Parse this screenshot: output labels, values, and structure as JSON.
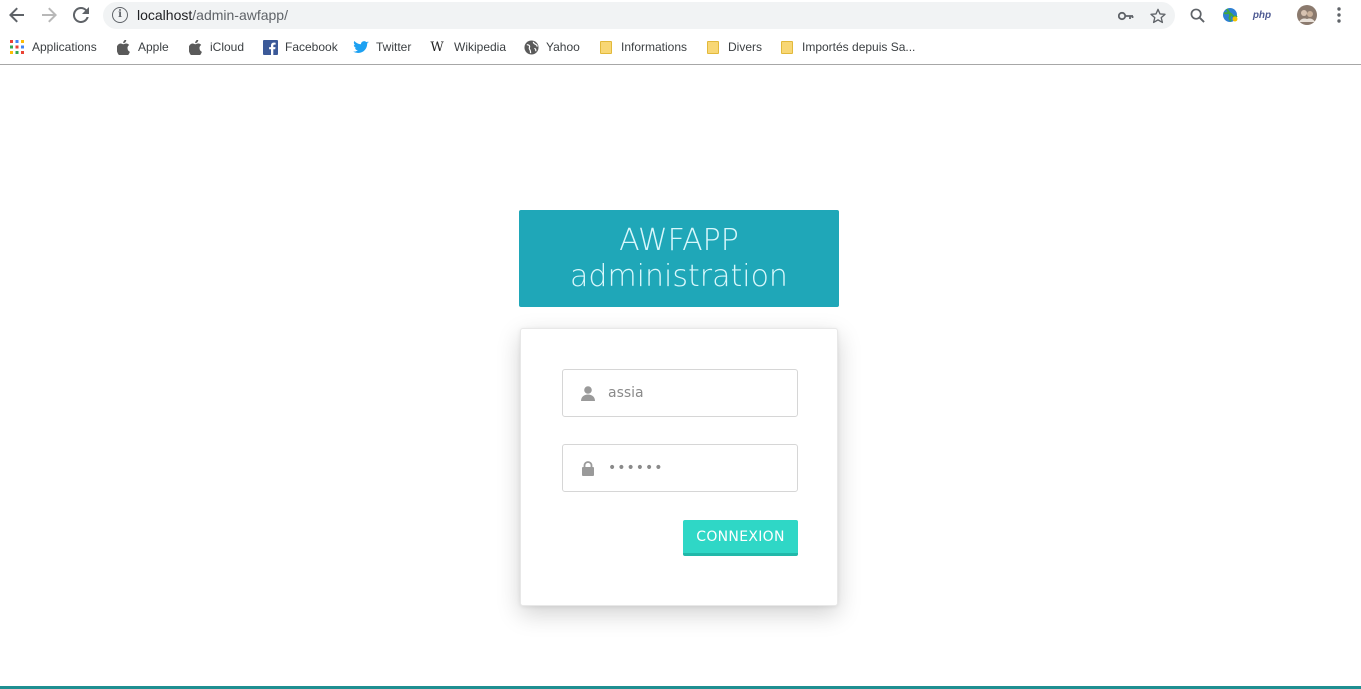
{
  "browser": {
    "url_host": "localhost",
    "url_path": "/admin-awfapp/",
    "php_label": "php"
  },
  "bookmarks": [
    {
      "label": "Applications",
      "icon": "apps-grid-icon"
    },
    {
      "label": "Apple",
      "icon": "apple-icon"
    },
    {
      "label": "iCloud",
      "icon": "apple-icon"
    },
    {
      "label": "Facebook",
      "icon": "facebook-icon"
    },
    {
      "label": "Twitter",
      "icon": "twitter-icon"
    },
    {
      "label": "Wikipedia",
      "icon": "wikipedia-icon"
    },
    {
      "label": "Yahoo",
      "icon": "globe-icon"
    },
    {
      "label": "Informations",
      "icon": "folder-icon"
    },
    {
      "label": "Divers",
      "icon": "folder-icon"
    },
    {
      "label": "Importés depuis Sa...",
      "icon": "folder-icon"
    }
  ],
  "page": {
    "title_line1": "AWFAPP",
    "title_line2": "administration",
    "username_value": "assia",
    "password_value": "••••••",
    "submit_label": "CONNEXION"
  },
  "colors": {
    "header_bg": "#1fa7b8",
    "button_bg": "#2fd7c6",
    "footer_line": "#1f8f91"
  }
}
